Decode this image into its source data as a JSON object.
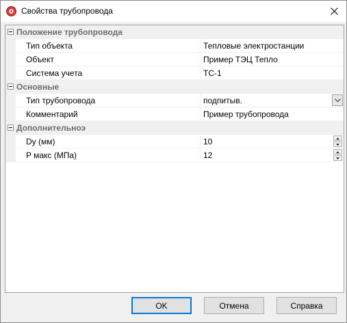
{
  "window": {
    "title": "Свойства трубопровода",
    "close_icon": "close-icon",
    "app_icon": "app-icon"
  },
  "grid": {
    "categories": [
      {
        "label": "Положение трубопровода",
        "properties": [
          {
            "name": "Тип объекта",
            "value": "Тепловые электростанции"
          },
          {
            "name": "Объект",
            "value": "Пример ТЭЦ Тепло"
          },
          {
            "name": "Система учета",
            "value": "ТС-1"
          }
        ]
      },
      {
        "label": "Основные",
        "properties": [
          {
            "name": "Тип трубопровода",
            "value": "подпитыв."
          },
          {
            "name": "Комментарий",
            "value": "Пример трубопровода"
          }
        ]
      },
      {
        "label": "Дополнительноэ",
        "properties": [
          {
            "name": "Dy (мм)",
            "value": "10"
          },
          {
            "name": "P макс (МПа)",
            "value": "12"
          }
        ]
      }
    ]
  },
  "buttons": {
    "ok": "OK",
    "cancel": "Отмена",
    "help": "Справка"
  }
}
